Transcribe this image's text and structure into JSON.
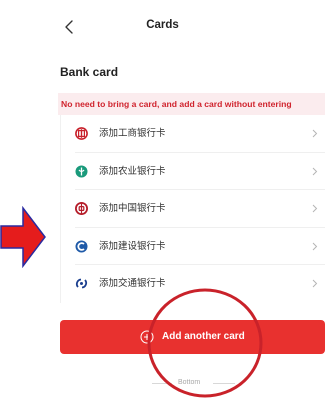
{
  "header": {
    "title": "Cards",
    "back_icon": "chevron-left-icon"
  },
  "section": {
    "title": "Bank card"
  },
  "notice": {
    "text": "No need to bring a card, and add a card without entering"
  },
  "cards": [
    {
      "label": "添加工商银行卡",
      "icon": "icbc-icon",
      "color": "#c8202a"
    },
    {
      "label": "添加农业银行卡",
      "icon": "abc-icon",
      "color": "#1a9a7b"
    },
    {
      "label": "添加中国银行卡",
      "icon": "boc-icon",
      "color": "#b51d2a"
    },
    {
      "label": "添加建设银行卡",
      "icon": "ccb-icon",
      "color": "#1f5aa8"
    },
    {
      "label": "添加交通银行卡",
      "icon": "bocom-icon",
      "color": "#1b3f8f"
    }
  ],
  "add_button": {
    "label": "Add another card",
    "icon": "plus-circle-icon",
    "color": "#e8312f"
  },
  "footer": {
    "text": "Bottom"
  },
  "annotations": {
    "arrow_color": "#e51c1c",
    "circle_color": "#c9222a"
  }
}
